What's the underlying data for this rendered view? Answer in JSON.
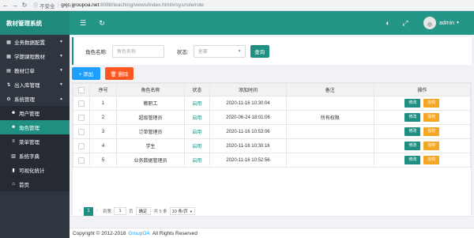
{
  "browser": {
    "not_secure": "不安全",
    "url_host": "gxjc.groupoa.net",
    "url_path": ":8088/teaching/views/index.html#/sys/role/role"
  },
  "header": {
    "app_title": "教材管理系统",
    "user_name": "admin"
  },
  "sidebar": {
    "items": [
      {
        "label": "业务数据配置",
        "icon": "▦",
        "arrow": "▼"
      },
      {
        "label": "学期课程教材",
        "icon": "▦",
        "arrow": "▼"
      },
      {
        "label": "教材订单",
        "icon": "▤",
        "arrow": "▼"
      },
      {
        "label": "出入库管理",
        "icon": "⇅",
        "arrow": "▼"
      },
      {
        "label": "系统管理",
        "icon": "⚙",
        "arrow": "▲"
      },
      {
        "label": "用户管理",
        "icon": "☻"
      },
      {
        "label": "角色管理",
        "icon": "☻"
      },
      {
        "label": "菜单管理",
        "icon": "≡"
      },
      {
        "label": "系统字典",
        "icon": "▥"
      },
      {
        "label": "可视化统计",
        "icon": "▮"
      },
      {
        "label": "首页",
        "icon": "⌂"
      }
    ]
  },
  "search": {
    "role_label": "角色名称:",
    "role_placeholder": "角色名称",
    "status_label": "状态:",
    "status_value": "全部",
    "query_label": "查询"
  },
  "toolbar": {
    "add_label": "+ 添加",
    "delete_label": "🗑 删除"
  },
  "table": {
    "headers": [
      "",
      "序号",
      "角色名称",
      "状态",
      "添加时间",
      "备注",
      "操作"
    ],
    "rows": [
      {
        "no": "1",
        "name": "教职工",
        "status": "启用",
        "time": "2020-11-16 10:30:04",
        "remark": ""
      },
      {
        "no": "2",
        "name": "超级管理员",
        "status": "启用",
        "time": "2020-06-24 18:01:06",
        "remark": "所有权限"
      },
      {
        "no": "3",
        "name": "订单管理员",
        "status": "启用",
        "time": "2020-11-16 10:53:06",
        "remark": ""
      },
      {
        "no": "4",
        "name": "学生",
        "status": "启用",
        "time": "2020-11-16 10:30:16",
        "remark": ""
      },
      {
        "no": "5",
        "name": "业务数据管理员",
        "status": "启用",
        "time": "2020-11-16 10:52:56",
        "remark": ""
      }
    ],
    "edit_label": "修改",
    "auth_label": "授权"
  },
  "pager": {
    "current_page": "1",
    "goto_label": "到第",
    "goto_value": "1",
    "page_unit": "页",
    "confirm_label": "确定",
    "total_label": "共 5 条",
    "size_label": "10 条/页"
  },
  "footer": {
    "copyright": "Copyright © 2012-2018",
    "brand": "GroupOA",
    "rights": "All Rights Reserved"
  },
  "colors": {
    "primary": "#1e8f80",
    "header": "#249687",
    "sidebar": "#2f3640",
    "add": "#1e9fff",
    "delete": "#ff5722",
    "auth": "#f5a623"
  }
}
